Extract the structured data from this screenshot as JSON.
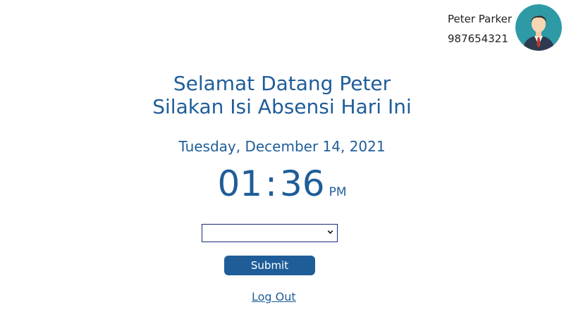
{
  "user": {
    "name": "Peter Parker",
    "phone": "987654321"
  },
  "greeting": {
    "line1": "Selamat Datang Peter",
    "line2": "Silakan Isi Absensi Hari Ini"
  },
  "date": "Tuesday, December 14, 2021",
  "clock": {
    "hour": "01",
    "minute": "36",
    "ampm": "PM"
  },
  "form": {
    "select_value": "",
    "submit_label": "Submit"
  },
  "logout_label": "Log Out",
  "colors": {
    "accent": "#1f5d99",
    "avatar_bg": "#2e9aa5"
  }
}
